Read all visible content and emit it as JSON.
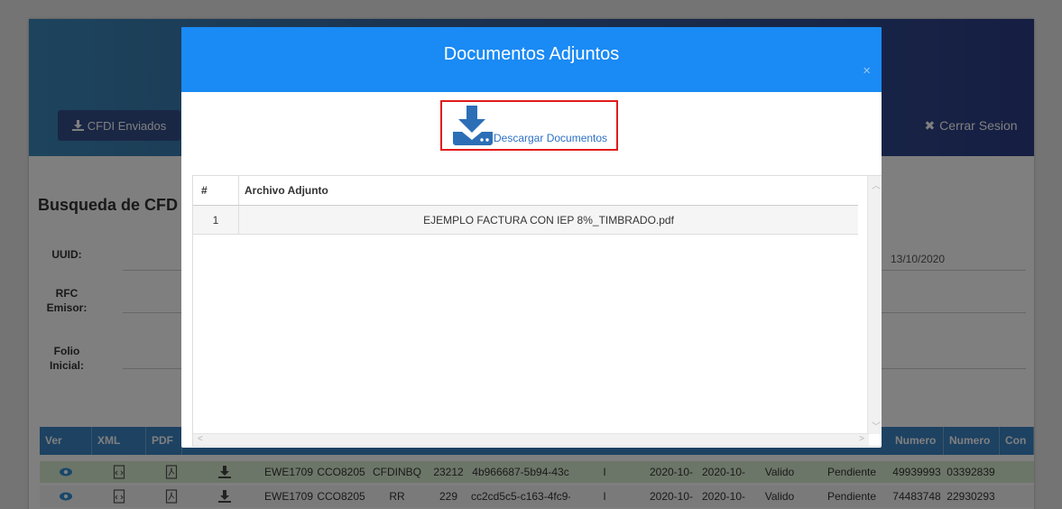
{
  "header": {
    "sent_button": "CFDI Enviados",
    "logout_button": "Cerrar Sesion"
  },
  "search": {
    "title": "Busqueda de CFD",
    "uuid_label": "UUID:",
    "rfc_label_1": "RFC",
    "rfc_label_2": "Emisor:",
    "folio_label_1": "Folio",
    "folio_label_2": "Inicial:",
    "date_value": "13/10/2020"
  },
  "table": {
    "columns": [
      "Ver",
      "XML",
      "PDF",
      "Numero",
      "Numero",
      "Con"
    ],
    "rows": [
      {
        "c1": "EWE1709",
        "c2": "CCO8205",
        "c3": "CFDINBQ",
        "c4": "23212",
        "c5": "4b966687-5b94-43c",
        "c6": "I",
        "c7": "2020-10-",
        "c8": "2020-10-",
        "c9": "Valido",
        "c10": "Pendiente",
        "c11": "49939993",
        "c12": "03392839"
      },
      {
        "c1": "EWE1709",
        "c2": "CCO8205",
        "c3": "RR",
        "c4": "229",
        "c5": "cc2cd5c5-c163-4fc9-",
        "c6": "I",
        "c7": "2020-10-",
        "c8": "2020-10-",
        "c9": "Valido",
        "c10": "Pendiente",
        "c11": "74483748",
        "c12": "22930293"
      }
    ]
  },
  "modal": {
    "title": "Documentos Adjuntos",
    "close": "×",
    "download_label": "Descargar Documentos",
    "file_table": {
      "col_num": "#",
      "col_file": "Archivo Adjunto",
      "rows": [
        {
          "num": "1",
          "file": "EJEMPLO FACTURA CON IEP 8%_TIMBRADO.pdf"
        }
      ]
    }
  },
  "colors": {
    "modal_header": "#1a8af4",
    "table_header": "#3a84c4",
    "highlight_box": "#e21b1b",
    "link": "#2d72c4"
  }
}
